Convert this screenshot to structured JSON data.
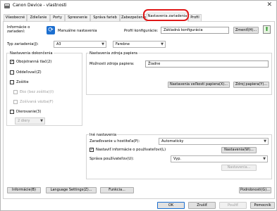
{
  "window": {
    "title": "Canon Device - vlastnosti",
    "close_glyph": "✕"
  },
  "tabs": [
    {
      "label": "Všeobecné"
    },
    {
      "label": "Zdieľanie"
    },
    {
      "label": "Porty"
    },
    {
      "label": "Spresnenie"
    },
    {
      "label": "Správa farieb"
    },
    {
      "label": "Zabezpečenie"
    },
    {
      "label": "Nastavenia zariadenia"
    },
    {
      "label": "Profil"
    }
  ],
  "top": {
    "device_info_label": "Informácie o zariadení:",
    "manual_settings": "Manuálne nastavenia",
    "config_profile_label": "Profil konfigurácie:",
    "config_profile_value": "Základná konfigurácia",
    "change_button": "Zmeniť(H)...",
    "paper_type_label": "Typ zariadenia(J):",
    "device_type_value": "A3",
    "color_value": "Farebne"
  },
  "finishing": {
    "title": "Nastavenia dokončenia",
    "duplex": "Obojstranná tlač(2)",
    "separator": "Oddeľovač(Z)",
    "stapler": "Zošitie",
    "stapleless": "Eko (bez zošitia)(I)",
    "saddle": "Zošívaná väzba(F)",
    "punch": "Dierovanie(3)",
    "holes_value": "2 diery"
  },
  "paper_source": {
    "title": "Nastavenia zdroja papiera",
    "option_label": "Možnosti zdroja papiera:",
    "option_value": "Žiadne",
    "size_settings_button": "Nastavenia veľkosti papiera(X)...",
    "source_button": "Zdroj papiera(Y)..."
  },
  "other": {
    "title": "Iné nastavenia",
    "spool_label": "Zaraďovanie u hostiteľa(P):",
    "spool_value": "Automaticky",
    "user_info_label": "Nastaviť informácie o používateľovi(L)",
    "user_settings_button": "Nastavenia(W)...",
    "user_mgmt_label": "Správa používateľov(U):",
    "user_mgmt_value": "Vyp.",
    "settings_button": "Nastavenia..."
  },
  "bottom": {
    "info": "Informácie(B)",
    "language": "Language Settings(Z)...",
    "function": "Funkcia...",
    "details": "Podrobnosti(G)..."
  },
  "dialog": {
    "ok": "OK",
    "cancel": "Zrušiť",
    "apply": "Použiť",
    "help": "Pomocník"
  }
}
